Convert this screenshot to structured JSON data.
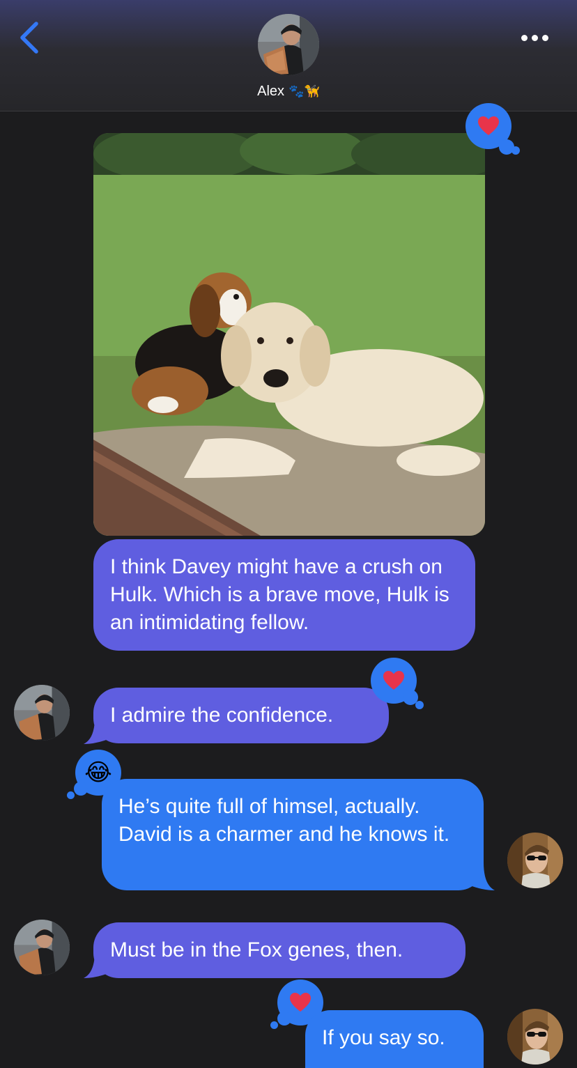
{
  "header": {
    "contact_name": "Alex",
    "name_emojis": "🐾🦮"
  },
  "messages": [
    {
      "id": "m1",
      "type": "image",
      "from": "them",
      "description_icon": "photo-dogs",
      "reaction": "heart"
    },
    {
      "id": "m2",
      "from": "them",
      "text": "I think Davey might have a crush on Hulk. Which is a brave move, Hulk is an intimidating fellow."
    },
    {
      "id": "m3",
      "from": "them",
      "text": "I admire the confidence.",
      "reaction": "heart"
    },
    {
      "id": "m4",
      "from": "me",
      "text": "He’s quite full of himsel, actually. David is a charmer and he knows it.",
      "reaction": "laughing"
    },
    {
      "id": "m5",
      "from": "them",
      "text": "Must be in the Fox genes, then."
    },
    {
      "id": "m6",
      "from": "me",
      "text": "If you say so.",
      "reaction": "heart"
    }
  ],
  "reactions": {
    "heart": "❤",
    "laughing": "😂"
  },
  "colors": {
    "them_bubble": "#5f5ee0",
    "me_bubble": "#2f7af2",
    "reaction_bg": "#2f7af2",
    "heart": "#e8344a",
    "background": "#1c1c1e",
    "accent": "#3478f6"
  }
}
